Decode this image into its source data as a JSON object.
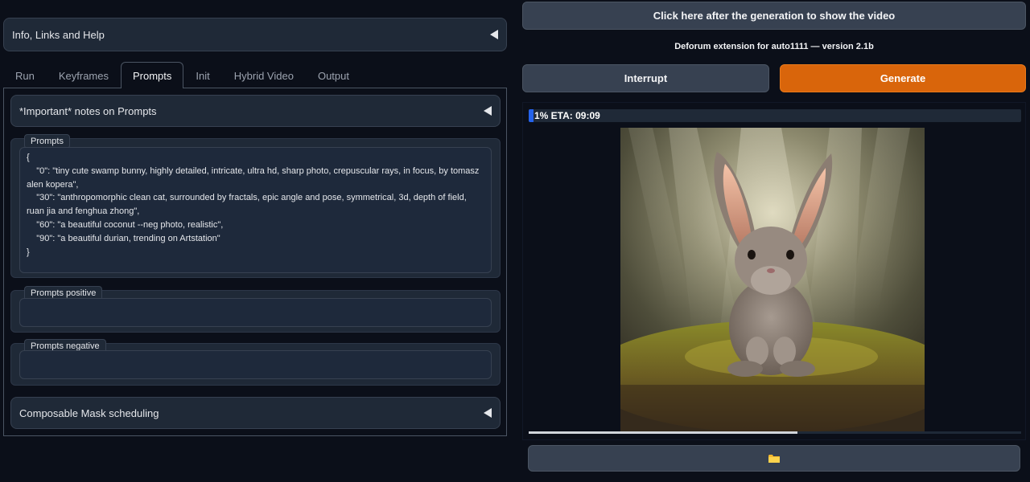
{
  "left": {
    "info_accordion": {
      "label": "Info, Links and Help"
    },
    "tabs": [
      {
        "label": "Run"
      },
      {
        "label": "Keyframes"
      },
      {
        "label": "Prompts",
        "active": true
      },
      {
        "label": "Init"
      },
      {
        "label": "Hybrid Video"
      },
      {
        "label": "Output"
      }
    ],
    "notes_accordion": {
      "label": "*Important* notes on Prompts"
    },
    "prompts": {
      "label": "Prompts",
      "lines": [
        "{",
        "    \"0\": \"tiny cute swamp bunny, highly detailed, intricate, ultra hd, sharp photo, crepuscular rays, in focus, by tomasz alen kopera\",",
        "    \"30\": \"anthropomorphic clean cat, surrounded by fractals, epic angle and pose, symmetrical, 3d, depth of field, ruan jia and fenghua zhong\",",
        "    \"60\": \"a beautiful coconut --neg photo, realistic\",",
        "    \"90\": \"a beautiful durian, trending on Artstation\"",
        "}"
      ]
    },
    "prompts_positive": {
      "label": "Prompts positive",
      "value": ""
    },
    "prompts_negative": {
      "label": "Prompts negative",
      "value": ""
    },
    "mask_accordion": {
      "label": "Composable Mask scheduling"
    }
  },
  "right": {
    "show_video_button": "Click here after the generation to show the video",
    "version_text": "Deforum extension for auto1111 — version 2.1b",
    "interrupt_button": "Interrupt",
    "generate_button": "Generate",
    "progress": {
      "text": "1% ETA: 09:09",
      "percent": 1
    },
    "folder_icon": "folder-icon"
  },
  "colors": {
    "accent": "#d9650b",
    "progress": "#2563eb",
    "background": "#0b0f19",
    "panel": "#1f2937"
  }
}
